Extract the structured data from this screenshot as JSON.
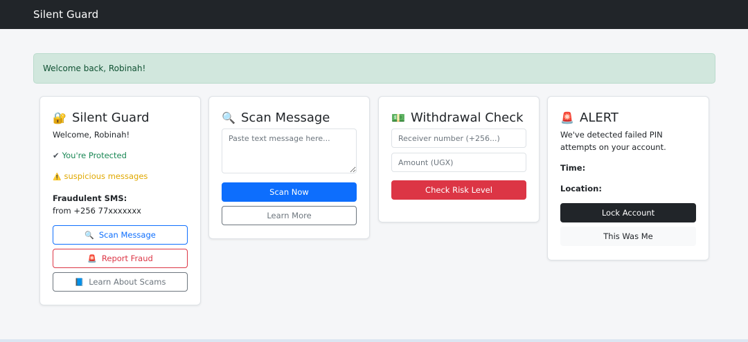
{
  "navbar": {
    "brand": "Silent Guard"
  },
  "flash": {
    "message": "Welcome back, Robinah!"
  },
  "card_guard": {
    "icon": "🔐",
    "title": "Silent Guard",
    "welcome": "Welcome, Robinah!",
    "protected_icon": "✔",
    "protected_text": "You're Protected",
    "suspicious_icon": "⚠️",
    "suspicious_text": "suspicious messages",
    "fraud_label": "Fraudulent SMS:",
    "fraud_from": "from +256 77xxxxxxx",
    "buttons": {
      "scan_icon": "🔍",
      "scan": "Scan Message",
      "report_icon": "🚨",
      "report": "Report Fraud",
      "learn_icon": "📘",
      "learn": "Learn About Scams"
    }
  },
  "card_scan": {
    "icon": "🔍",
    "title": "Scan Message",
    "textarea_placeholder": "Paste text message here...",
    "textarea_value": "",
    "scan_button": "Scan Now",
    "learn_button": "Learn More"
  },
  "card_withdrawal": {
    "icon": "💵",
    "title": "Withdrawal Check",
    "receiver_placeholder": "Receiver number (+256...)",
    "amount_placeholder": "Amount (UGX)",
    "check_button": "Check Risk Level"
  },
  "card_alert": {
    "icon": "🚨",
    "title": "ALERT",
    "message": "We've detected failed PIN attempts on your account.",
    "time_label": "Time:",
    "location_label": "Location:",
    "lock_button": "Lock Account",
    "me_button": "This Was Me"
  },
  "colors": {
    "navbar": "#212529",
    "success_bg": "#d1e7dd",
    "primary": "#0d6efd",
    "danger": "#dc3545",
    "dark": "#212529"
  }
}
